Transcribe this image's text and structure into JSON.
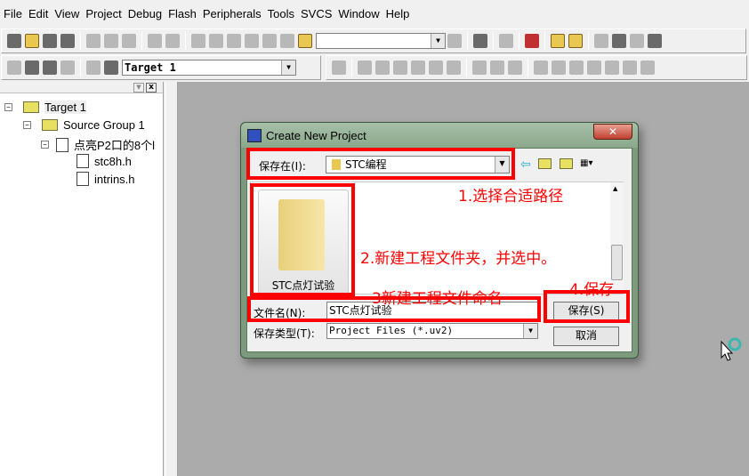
{
  "menu": [
    "File",
    "Edit",
    "View",
    "Project",
    "Debug",
    "Flash",
    "Peripherals",
    "Tools",
    "SVCS",
    "Window",
    "Help"
  ],
  "toolbar": {
    "target_select": "Target 1"
  },
  "project_tree": {
    "target": "Target 1",
    "group": "Source Group 1",
    "file": "点亮P2口的8个l",
    "children": [
      "stc8h.h",
      "intrins.h"
    ]
  },
  "dialog": {
    "title": "Create New Project",
    "save_in_label": "保存在(I):",
    "save_in_value": "STC编程",
    "folder_item": "STC点灯试验",
    "filename_label": "文件名(N):",
    "filename_value": "STC点灯试验",
    "filetype_label": "保存类型(T):",
    "filetype_value": "Project Files (*.uv2)",
    "save_button": "保存(S)",
    "cancel_button": "取消",
    "close": "✕"
  },
  "annotations": [
    "1.选择合适路径",
    "2.新建工程文件夹，并选中。",
    "3新建工程文件命名",
    "4.保存"
  ],
  "colors": {
    "annotation": "#ff0000",
    "workspace": "#ababab"
  }
}
